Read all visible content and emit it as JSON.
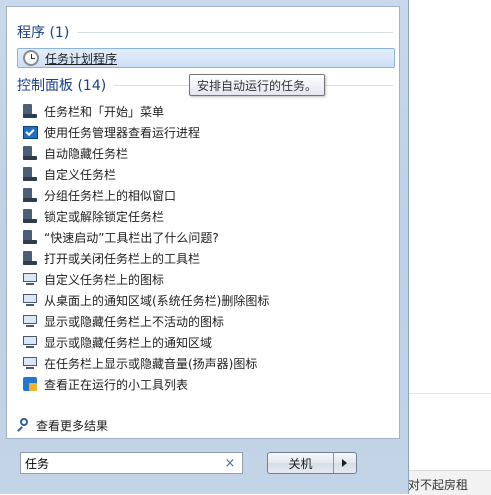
{
  "programs": {
    "header": "程序 (1)",
    "items": [
      {
        "label": "任务计划程序",
        "icon": "clock-icon",
        "selected": true
      }
    ]
  },
  "control_panel": {
    "header": "控制面板 (14)",
    "items": [
      {
        "label": "任务栏和「开始」菜单",
        "icon": "taskbar-icon"
      },
      {
        "label": "使用任务管理器查看运行进程",
        "icon": "task-manager-icon"
      },
      {
        "label": "自动隐藏任务栏",
        "icon": "taskbar-icon"
      },
      {
        "label": "自定义任务栏",
        "icon": "taskbar-icon"
      },
      {
        "label": "分组任务栏上的相似窗口",
        "icon": "taskbar-icon"
      },
      {
        "label": "锁定或解除锁定任务栏",
        "icon": "taskbar-icon"
      },
      {
        "label": "“快速启动”工具栏出了什么问题?",
        "icon": "taskbar-icon"
      },
      {
        "label": "打开或关闭任务栏上的工具栏",
        "icon": "taskbar-icon"
      },
      {
        "label": "自定义任务栏上的图标",
        "icon": "monitor-icon"
      },
      {
        "label": "从桌面上的通知区域(系统任务栏)删除图标",
        "icon": "monitor-icon"
      },
      {
        "label": "显示或隐藏任务栏上不活动的图标",
        "icon": "monitor-icon"
      },
      {
        "label": "显示或隐藏任务栏上的通知区域",
        "icon": "monitor-icon"
      },
      {
        "label": "在任务栏上显示或隐藏音量(扬声器)图标",
        "icon": "monitor-icon"
      },
      {
        "label": "查看正在运行的小工具列表",
        "icon": "gadget-icon"
      }
    ]
  },
  "tooltip": "安排自动运行的任务。",
  "see_more": "查看更多结果",
  "search": {
    "value": "任务",
    "clear_icon": "×"
  },
  "shutdown": {
    "label": "关机"
  },
  "background": {
    "status_text": "对不起房租"
  },
  "colors": {
    "header_blue": "#1a3e8f",
    "selection_border": "#8bb3e2",
    "frame": "#c4d4e7"
  }
}
